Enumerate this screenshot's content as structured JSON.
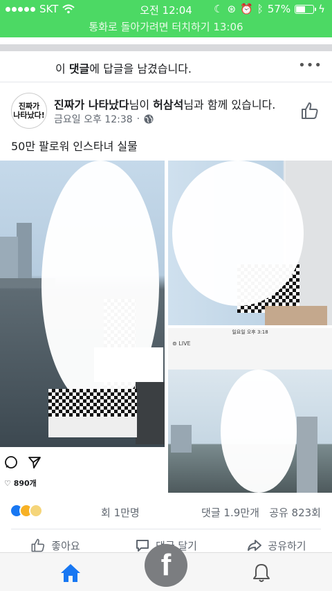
{
  "status_bar": {
    "carrier": "SKT",
    "time": "오전 12:04",
    "battery_percent": "57%",
    "battery_level": 0.57,
    "call_banner": "통화로 돌아가려면 터치하기 13:06"
  },
  "notice": {
    "prefix": "",
    "suffix": "이 ",
    "highlight": "댓글",
    "rest": "에 답글을 남겼습니다.",
    "more_icon": "more-icon"
  },
  "post": {
    "avatar_text_line1": "진짜가",
    "avatar_text_line2": "나타났다!",
    "author": "진짜가 나타났다",
    "author_suffix": "님이 ",
    "with_person": "허삼석",
    "with_suffix": "님과 함께 있습니다.",
    "time": "금요일 오후 12:38",
    "dot": "·",
    "text": "50만 팔로워 인스타녀 실물",
    "inner_screenshot_time": "일요일 오후 3:18",
    "inner_live": "LIVE",
    "inner_likes": "890개"
  },
  "counts": {
    "reactions": "1만명",
    "reactions_prefix": "회",
    "comments": "댓글 1.9만개",
    "shares": "공유 823회"
  },
  "actions": {
    "like": "좋아요",
    "comment": "댓글 달기",
    "share": "공유하기"
  },
  "colors": {
    "status_green": "#4cd964",
    "facebook_blue": "#1877f2"
  }
}
